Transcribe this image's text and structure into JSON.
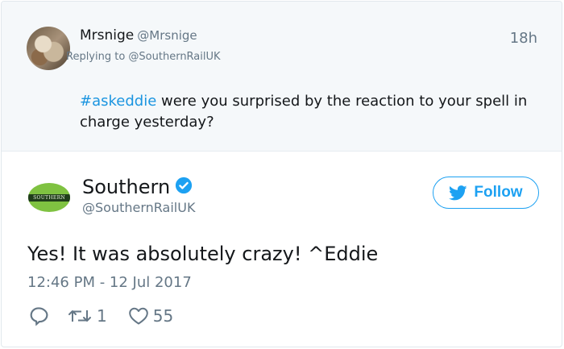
{
  "original": {
    "author_name": "Mrsnige",
    "author_handle": "@Mrsnige",
    "time": "18h",
    "replying_to": "Replying to @SouthernRailUK",
    "hashtag": "#askeddie",
    "text": " were you surprised by the reaction to your spell in charge yesterday?"
  },
  "tweet": {
    "author_name": "Southern",
    "author_handle": "@SouthernRailUK",
    "avatar_text": "SOUTHERN",
    "follow_label": "Follow",
    "text": "Yes! It was absolutely crazy! ^Eddie",
    "timestamp": "12:46 PM - 12 Jul 2017",
    "retweet_count": "1",
    "like_count": "55"
  },
  "colors": {
    "accent": "#1da1f2",
    "hashtag": "#1b95e0",
    "muted": "#657786",
    "reply_bg": "#f5f8fa",
    "southern_green": "#7fc241"
  },
  "icons": [
    "verified-icon",
    "twitter-bird-icon",
    "reply-icon",
    "retweet-icon",
    "like-icon"
  ]
}
